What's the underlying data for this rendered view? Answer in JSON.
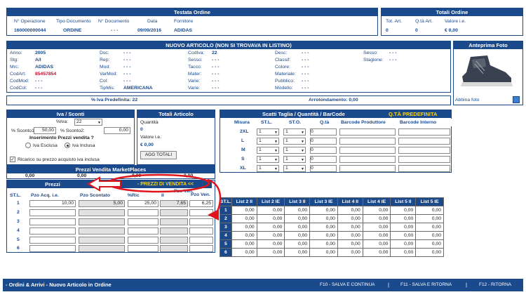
{
  "testata": {
    "title": "Testata Ordine",
    "headers": [
      "N° Operazione",
      "Tipo Documento",
      "N° Documento",
      "Data",
      "Fornitore"
    ],
    "values": [
      "160000000044",
      "ORDINE",
      "- - -",
      "09/09/2016",
      "ADIDAS"
    ]
  },
  "totali_ordine": {
    "title": "Totali Ordine",
    "headers": [
      "Tot. Art.",
      "Q.tà Art.",
      "Valore i.e."
    ],
    "values": [
      "0",
      "0",
      "€ 0,00"
    ]
  },
  "articolo": {
    "title": "NUOVO ARTICOLO (NON SI TROVAVA IN LISTINO)",
    "col1": [
      {
        "label": "Anno:",
        "value": "2005"
      },
      {
        "label": "Stg:",
        "value": "A/I"
      },
      {
        "label": "Mrc:",
        "value": "ADIDAS"
      },
      {
        "label": "CodArt:",
        "value": "85457854"
      },
      {
        "label": "CodMod:",
        "value": "- - -"
      },
      {
        "label": "CodCol:",
        "value": "- - -"
      }
    ],
    "col2": [
      {
        "label": "Dsc:",
        "value": "- - -"
      },
      {
        "label": "Rep:",
        "value": "- - -"
      },
      {
        "label": "Mod:",
        "value": "- - -"
      },
      {
        "label": "VarMod:",
        "value": "- - -"
      },
      {
        "label": "Col:",
        "value": "- - -"
      },
      {
        "label": "TipMis:",
        "value": "AMERICANA"
      }
    ],
    "col3": [
      {
        "label": "CodIva:",
        "value": "22"
      },
      {
        "label": "Sesso:",
        "value": "- - -"
      },
      {
        "label": "Tacco:",
        "value": "- - -"
      },
      {
        "label": "Mater:",
        "value": "- - -"
      },
      {
        "label": "Varie:",
        "value": "- - -"
      },
      {
        "label": "Varie:",
        "value": "- - -"
      }
    ],
    "col4": [
      {
        "label": "Desc:",
        "value": "- - -"
      },
      {
        "label": "Classif:",
        "value": "- - -"
      },
      {
        "label": "Colore:",
        "value": "- - -"
      },
      {
        "label": "Materiale:",
        "value": "- - -"
      },
      {
        "label": "Pubblico:",
        "value": "- - -"
      },
      {
        "label": "Modello:",
        "value": "- - -"
      }
    ],
    "col5": [
      {
        "label": "Sesso:",
        "value": "- - -"
      },
      {
        "label": "Stagione:",
        "value": "- - -"
      }
    ],
    "iva_predefinita": "% Iva Predefinita: 22",
    "arrotondamento": "Arrotondamento: 0,00"
  },
  "anteprima": {
    "title": "Anteprima Foto",
    "link": "Abbina foto"
  },
  "iva_sconti": {
    "title": "Iva / Sconti",
    "iva_label": "%Iva:",
    "iva_value": "22",
    "sconto1_label": "% Sconto1:",
    "sconto1_value": "50,00",
    "sconto2_label": "% Sconto2:",
    "sconto2_value": "0,00",
    "inserimento_label": "Inserimento Prezzi vendita ?",
    "radio_esclusa": "Iva Esclusa",
    "radio_inclusa": "Iva Inclusa",
    "ricarico_label": "Ricarico su prezzo acquisto iva inclusa"
  },
  "totali_articolo": {
    "title": "Totali Articolo",
    "quantita_label": "Quantità",
    "quantita_value": "0",
    "valore_label": "Valore i.e.",
    "valore_value": "€ 0,00",
    "button": "AGG TOTALI"
  },
  "marketplaces": {
    "title": "Prezzi Vendita MarketPlaces",
    "values": [
      "0,00",
      "0,00",
      "0,00",
      "0,00"
    ]
  },
  "prezzi": {
    "title": "Prezzi",
    "banner": "- PREZZI DI VENDITA <<",
    "headers": [
      "ST.L.",
      "Pzo Acq. i.e.",
      "Pzo Scontato",
      "%Ric",
      "II",
      "Pzo Ven.",
      "Pzo Ven."
    ],
    "rows": [
      {
        "stl": "1",
        "acq": "10,00",
        "scontato": "5,00",
        "ric": "25,00",
        "ii": "7,65",
        "ven": "6,25"
      },
      {
        "stl": "2",
        "acq": "",
        "scontato": "",
        "ric": "",
        "ii": "",
        "ven": ""
      },
      {
        "stl": "3",
        "acq": "",
        "scontato": "",
        "ric": "",
        "ii": "",
        "ven": ""
      },
      {
        "stl": "4",
        "acq": "",
        "scontato": "",
        "ric": "",
        "ii": "",
        "ven": ""
      },
      {
        "stl": "5",
        "acq": "",
        "scontato": "",
        "ric": "",
        "ii": "",
        "ven": ""
      },
      {
        "stl": "6",
        "acq": "",
        "scontato": "",
        "ric": "",
        "ii": "",
        "ven": ""
      }
    ]
  },
  "scatti": {
    "title": "Scatti Taglia / Quantità / BarCode",
    "predefinita": "Q.TÀ PREDEFINITA",
    "headers": [
      "Misura",
      "ST.L.",
      "ST.O.",
      "Q.tà",
      "Barcode Produttore",
      "Barcode Interno"
    ],
    "rows": [
      {
        "misura": "2XL",
        "stl": "1",
        "sto": "1",
        "qta": "0"
      },
      {
        "misura": "L",
        "stl": "1",
        "sto": "1",
        "qta": "0"
      },
      {
        "misura": "M",
        "stl": "1",
        "sto": "1",
        "qta": "0"
      },
      {
        "misura": "S",
        "stl": "1",
        "sto": "1",
        "qta": "0"
      },
      {
        "misura": "XL",
        "stl": "1",
        "sto": "1",
        "qta": "0"
      }
    ]
  },
  "listini": {
    "headers": [
      "ST.L.",
      "List 2 II",
      "List 2 IE",
      "List 3 II",
      "List 3 IE",
      "List 4 II",
      "List 4 IE",
      "List 5 II",
      "List 5 IE"
    ],
    "rows": [
      [
        "1",
        "0,00",
        "0,00",
        "0,00",
        "0,00",
        "0,00",
        "0,00",
        "0,00",
        "0,00"
      ],
      [
        "2",
        "0,00",
        "0,00",
        "0,00",
        "0,00",
        "0,00",
        "0,00",
        "0,00",
        "0,00"
      ],
      [
        "3",
        "0,00",
        "0,00",
        "0,00",
        "0,00",
        "0,00",
        "0,00",
        "0,00",
        "0,00"
      ],
      [
        "4",
        "0,00",
        "0,00",
        "0,00",
        "0,00",
        "0,00",
        "0,00",
        "0,00",
        "0,00"
      ],
      [
        "5",
        "0,00",
        "0,00",
        "0,00",
        "0,00",
        "0,00",
        "0,00",
        "0,00",
        "0,00"
      ],
      [
        "6",
        "0,00",
        "0,00",
        "0,00",
        "0,00",
        "0,00",
        "0,00",
        "0,00",
        "0,00"
      ]
    ]
  },
  "footer": {
    "title": "- Ordini & Arrivi - Nuovo Articolo in Ordine",
    "f10": "F10 - SALVA E CONTINUA",
    "f11": "F11 - SALVA E RITORNA",
    "f12": "F12 - RITORNA"
  }
}
